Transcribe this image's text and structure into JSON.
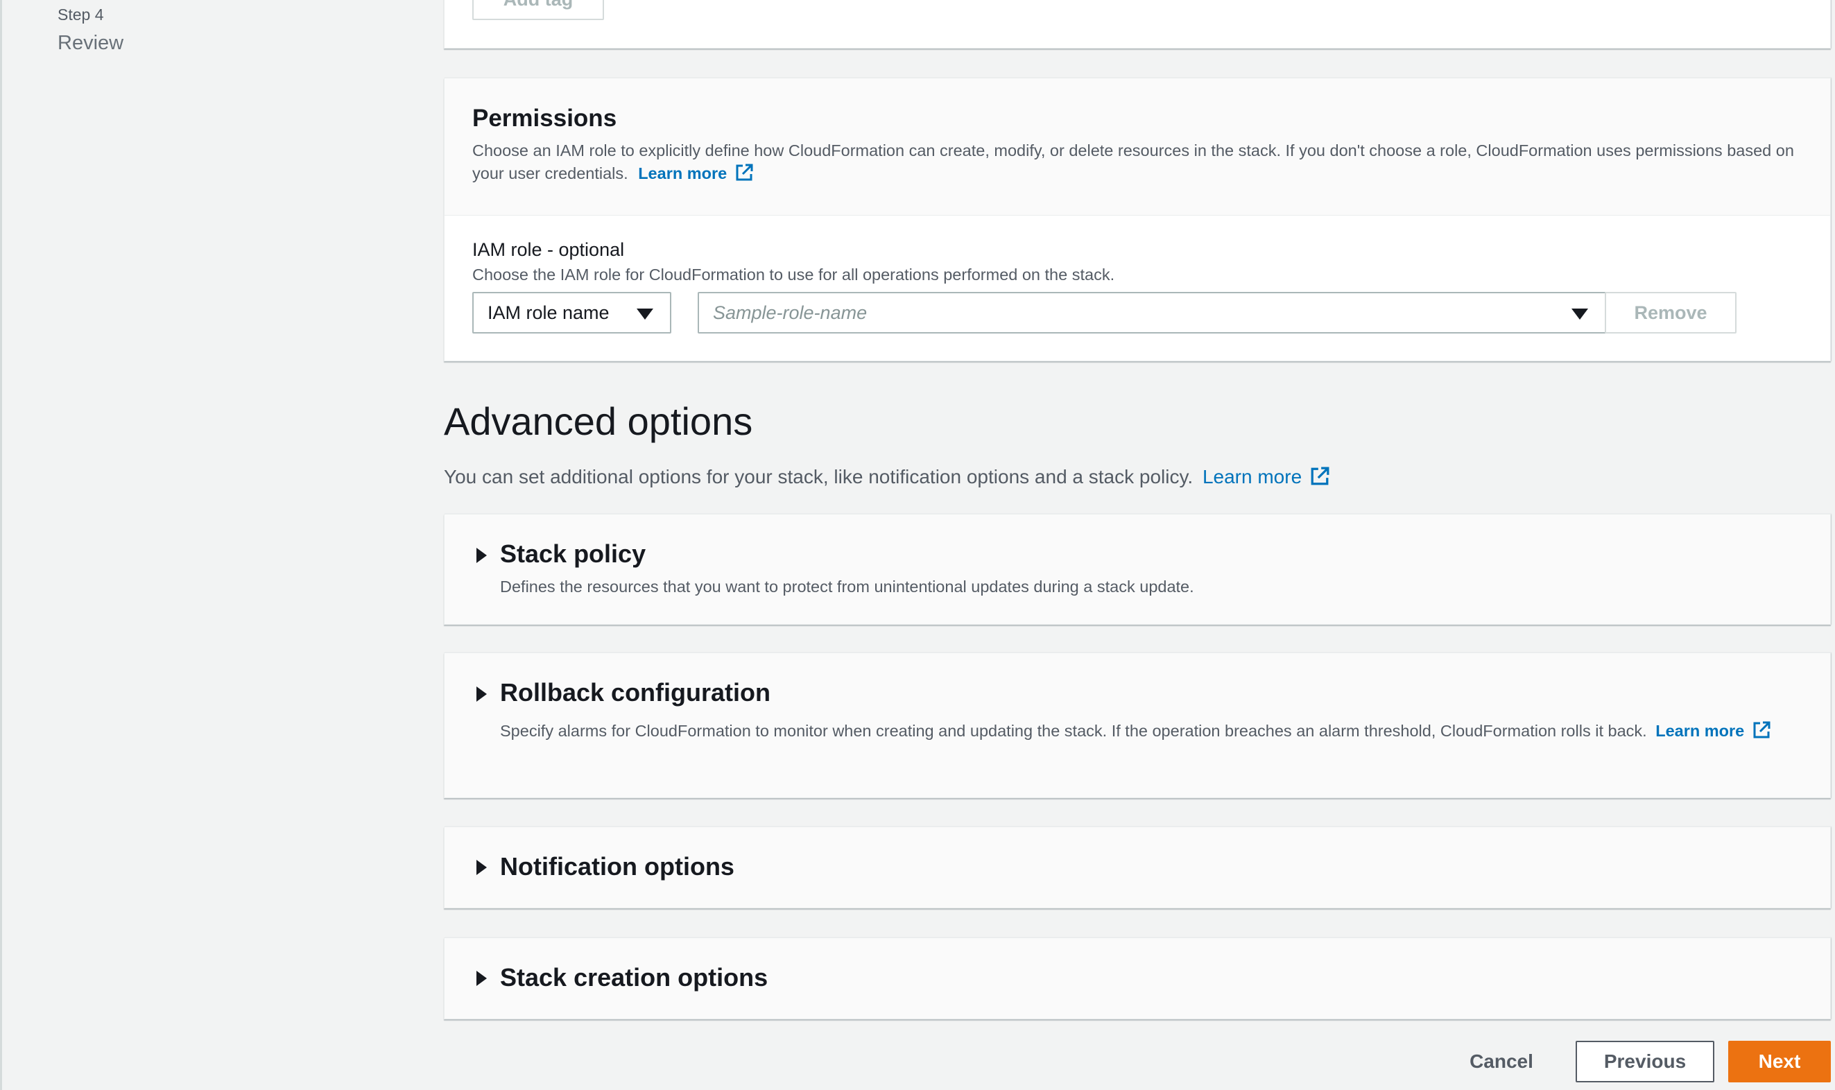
{
  "sidebar": {
    "step_label": "Step 4",
    "step_name": "Review"
  },
  "tags": {
    "add_tag_label": "Add tag"
  },
  "permissions": {
    "title": "Permissions",
    "description": "Choose an IAM role to explicitly define how CloudFormation can create, modify, or delete resources in the stack. If you don't choose a role, CloudFormation uses permissions based on your user credentials.",
    "learn_more": "Learn more",
    "iam_role_label": "IAM role - optional",
    "iam_role_description": "Choose the IAM role for CloudFormation to use for all operations performed on the stack.",
    "iam_type_selected": "IAM role name",
    "iam_role_placeholder": "Sample-role-name",
    "remove_label": "Remove"
  },
  "advanced": {
    "title": "Advanced options",
    "description": "You can set additional options for your stack, like notification options and a stack policy.",
    "learn_more": "Learn more",
    "sections": [
      {
        "title": "Stack policy",
        "description": "Defines the resources that you want to protect from unintentional updates during a stack update."
      },
      {
        "title": "Rollback configuration",
        "description": "Specify alarms for CloudFormation to monitor when creating and updating the stack. If the operation breaches an alarm threshold, CloudFormation rolls it back.",
        "learn_more": "Learn more"
      },
      {
        "title": "Notification options"
      },
      {
        "title": "Stack creation options"
      }
    ]
  },
  "footer": {
    "cancel": "Cancel",
    "previous": "Previous",
    "next": "Next"
  },
  "colors": {
    "accent": "#ec7211",
    "link": "#0073bb"
  }
}
